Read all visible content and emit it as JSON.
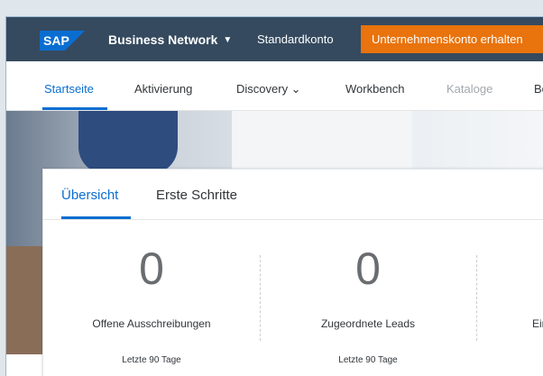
{
  "header": {
    "logo": "SAP",
    "brand": "Business Network",
    "account": "Standardkonto",
    "upgrade_button": "Unternehmenskonto erhalten",
    "colors": {
      "bar": "#354a5f",
      "accent": "#e9730c",
      "logo": "#0a6ed1"
    }
  },
  "nav": {
    "items": [
      {
        "label": "Startseite"
      },
      {
        "label": "Aktivierung"
      },
      {
        "label": "Discovery ⌄"
      },
      {
        "label": "Workbench"
      },
      {
        "label": "Kataloge"
      },
      {
        "label": "Bo"
      }
    ]
  },
  "card": {
    "tabs": [
      {
        "label": "Übersicht"
      },
      {
        "label": "Erste Schritte"
      }
    ],
    "tiles": [
      {
        "value": "0",
        "label": "Offene Ausschreibungen",
        "period": "Letzte 90 Tage"
      },
      {
        "value": "0",
        "label": "Zugeordnete Leads",
        "period": "Letzte 90 Tage"
      },
      {
        "value": "",
        "label": "Ein",
        "period": ""
      }
    ]
  }
}
